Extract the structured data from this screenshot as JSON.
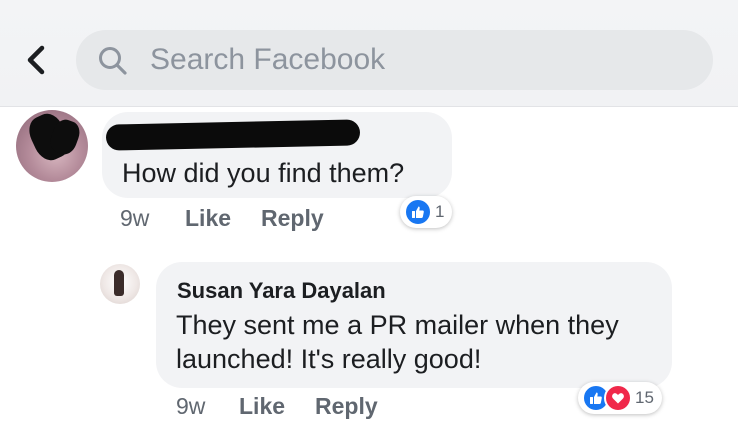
{
  "search": {
    "placeholder": "Search Facebook"
  },
  "colors": {
    "like_blue": "#1877f2",
    "love_red": "#f0284a",
    "bubble_bg": "#f2f3f5",
    "meta_gray": "#606770"
  },
  "icons": {
    "back": "chevron-left-icon",
    "search": "search-icon",
    "like": "like-reaction-icon",
    "love": "love-reaction-icon"
  },
  "comments": [
    {
      "text": "How did you find them?",
      "time": "9w",
      "like_label": "Like",
      "reply_label": "Reply",
      "reaction_count": "1"
    },
    {
      "author": "Susan Yara Dayalan",
      "lines": [
        "They sent me a PR mailer when they",
        "launched! It's really good!"
      ],
      "time": "9w",
      "like_label": "Like",
      "reply_label": "Reply",
      "reaction_count": "15"
    }
  ]
}
